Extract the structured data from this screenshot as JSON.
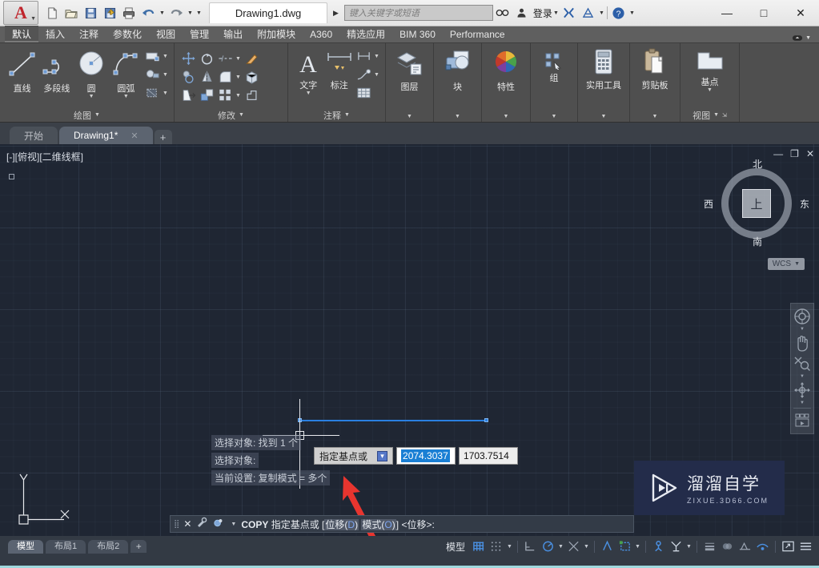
{
  "titlebar": {
    "logo_letter": "A",
    "document_title": "Drawing1.dwg",
    "search_placeholder": "键入关键字或短语",
    "login_label": "登录",
    "quick_access": [
      {
        "name": "new-file",
        "label": "新建"
      },
      {
        "name": "open-file",
        "label": "打开"
      },
      {
        "name": "save-file",
        "label": "保存"
      },
      {
        "name": "save-as",
        "label": "另存为"
      },
      {
        "name": "plot",
        "label": "打印"
      },
      {
        "name": "undo",
        "label": "放弃"
      },
      {
        "name": "redo",
        "label": "重做"
      },
      {
        "name": "customize-qat",
        "label": "自定义快速访问工具栏"
      }
    ],
    "window_buttons": {
      "minimize": "—",
      "maximize": "□",
      "close": "✕"
    }
  },
  "ribbon": {
    "tabs": [
      {
        "label": "默认",
        "active": true
      },
      {
        "label": "插入",
        "active": false
      },
      {
        "label": "注释",
        "active": false
      },
      {
        "label": "参数化",
        "active": false
      },
      {
        "label": "视图",
        "active": false
      },
      {
        "label": "管理",
        "active": false
      },
      {
        "label": "输出",
        "active": false
      },
      {
        "label": "附加模块",
        "active": false
      },
      {
        "label": "A360",
        "active": false
      },
      {
        "label": "精选应用",
        "active": false
      },
      {
        "label": "BIM 360",
        "active": false
      },
      {
        "label": "Performance",
        "active": false
      }
    ],
    "panels": [
      {
        "title": "绘图",
        "buttons": [
          "直线",
          "多段线",
          "圆",
          "圆弧"
        ]
      },
      {
        "title": "修改",
        "buttons": []
      },
      {
        "title": "注释",
        "buttons": [
          "文字",
          "标注"
        ]
      },
      {
        "title": "图层",
        "buttons": [
          "图层"
        ]
      },
      {
        "title": "块",
        "buttons": [
          "块"
        ]
      },
      {
        "title": "特性",
        "buttons": [
          "特性"
        ]
      },
      {
        "title": "组",
        "buttons": [
          "组"
        ]
      },
      {
        "title": "实用工具",
        "buttons": [
          "实用工具"
        ]
      },
      {
        "title": "剪贴板",
        "buttons": [
          "剪贴板"
        ]
      },
      {
        "title": "视图",
        "buttons": [
          "基点"
        ]
      }
    ],
    "draw_panel_title": "绘图",
    "modify_panel_title": "修改",
    "annotate_panel_title": "注释",
    "view_panel_title": "视图",
    "btn_line": "直线",
    "btn_polyline": "多段线",
    "btn_circle": "圆",
    "btn_arc": "圆弧",
    "btn_text": "文字",
    "btn_dimension": "标注",
    "btn_layer": "图层",
    "btn_block": "块",
    "btn_properties": "特性",
    "btn_group": "组",
    "btn_utilities": "实用工具",
    "btn_clipboard": "剪贴板",
    "btn_basepoint": "基点"
  },
  "file_tabs": {
    "start_tab": "开始",
    "drawing_tab": "Drawing1*",
    "close_glyph": "✕",
    "plus_glyph": "+"
  },
  "canvas": {
    "viewport_label": "[-][俯视][二维线框]",
    "viewcube": {
      "top_face": "上",
      "north": "北",
      "south": "南",
      "west": "西",
      "east": "东",
      "ucs_label": "WCS"
    },
    "ucs_axis_x": "X",
    "ucs_axis_y": "Y",
    "dynamic_input": {
      "prompt": "指定基点或",
      "dropdown_glyph": "▾",
      "x_value": "2074.3037",
      "y_value": "1703.7514"
    },
    "viewport_window_buttons": {
      "minimize": "—",
      "restore": "❐",
      "close": "✕"
    },
    "selected_line_color": "#2a7fe0",
    "background_color": "#1f2633"
  },
  "command": {
    "history": [
      "选择对象: 找到 1 个",
      "选择对象:",
      "当前设置:  复制模式 = 多个"
    ],
    "prompt_command": "COPY",
    "prompt_text": "指定基点或",
    "option_displacement": "位移",
    "option_displacement_key": "D",
    "option_mode": "模式",
    "option_mode_key": "O",
    "prompt_default": "<位移>:",
    "close_glyph": "✕"
  },
  "statusbar": {
    "layout_tabs": [
      {
        "label": "模型",
        "active": true
      },
      {
        "label": "布局1",
        "active": false
      },
      {
        "label": "布局2",
        "active": false
      }
    ],
    "add_layout_glyph": "+",
    "space_label": "模型",
    "toggles": [
      {
        "name": "grid-display",
        "label": "栅格显示",
        "on": true
      },
      {
        "name": "snap-mode",
        "label": "捕捉模式",
        "on": false
      },
      {
        "name": "ortho-mode",
        "label": "正交模式",
        "on": false
      },
      {
        "name": "polar-tracking",
        "label": "极轴追踪",
        "on": true
      },
      {
        "name": "object-snap-tracking",
        "label": "对象捕捉追踪",
        "on": false
      },
      {
        "name": "dynamic-ucs",
        "label": "允许/禁止动态 UCS",
        "on": true
      },
      {
        "name": "dynamic-input",
        "label": "动态输入",
        "on": true
      },
      {
        "name": "object-snap",
        "label": "对象捕捉",
        "on": true
      },
      {
        "name": "show-lineweight",
        "label": "显示/隐藏线宽",
        "on": false
      },
      {
        "name": "fullscreen",
        "label": "全屏显示",
        "on": false
      },
      {
        "name": "customization",
        "label": "自定义",
        "on": false
      }
    ]
  },
  "watermark": {
    "title": "溜溜自学",
    "url": "ZIXUE.3D66.COM"
  }
}
